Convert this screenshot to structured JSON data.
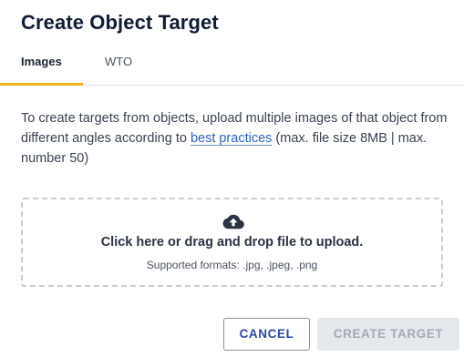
{
  "dialog": {
    "title": "Create Object Target"
  },
  "tabs": [
    {
      "label": "Images",
      "active": true
    },
    {
      "label": "WTO",
      "active": false
    }
  ],
  "description": {
    "before_link": "To create targets from objects, upload multiple images of that object from different angles according to ",
    "link_text": "best practices",
    "after_link": " (max. file size 8MB | max. number 50)"
  },
  "dropzone": {
    "icon": "cloud-upload-icon",
    "title": "Click here or drag and drop file to upload.",
    "formats": "Supported formats: .jpg, .jpeg, .png"
  },
  "actions": {
    "cancel_label": "CANCEL",
    "create_label": "CREATE TARGET",
    "create_enabled": false
  },
  "colors": {
    "active_tab_indicator": "#f2b51e",
    "link": "#2d63c8",
    "cancel_text": "#2a4aa0",
    "disabled_bg": "#e5e8ec",
    "disabled_text": "#a4aab3"
  }
}
